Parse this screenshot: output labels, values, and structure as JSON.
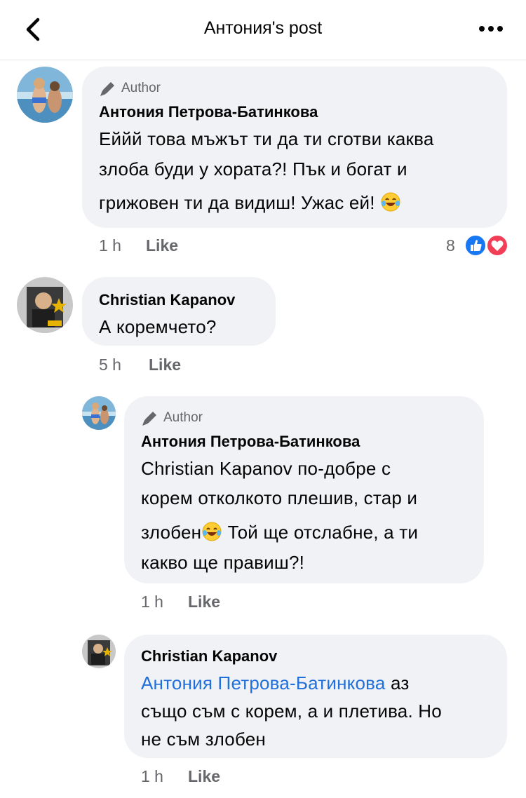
{
  "header": {
    "title": "Антония's post"
  },
  "comments": [
    {
      "author_badge": "Author",
      "name": "Антония Петрова-Батинкова",
      "lines": [
        "Еййй това мъжът ти да ти сготви каква",
        "злоба буди у хората?! Пък и богат и",
        "грижовен ти да видиш! Ужас ей!"
      ],
      "time": "1 h",
      "like_label": "Like",
      "reaction_count": "8"
    },
    {
      "name": "Christian Kapanov",
      "lines": [
        "А коремчето?"
      ],
      "time": "5 h",
      "like_label": "Like"
    },
    {
      "author_badge": "Author",
      "name": "Антония Петрова-Батинкова",
      "lines": [
        "Christian Kapanov по-добре с",
        "корем отколкото плешив, стар и",
        "злобен",
        " Той ще отслабне, а ти",
        "какво ще правиш?!"
      ],
      "time": "1 h",
      "like_label": "Like"
    },
    {
      "name": "Christian Kapanov",
      "mention": "Антония Петрова-Батинкова",
      "lines": [
        " аз",
        "също съм с корем, а и плетива. Но",
        "не съм злобен"
      ],
      "time": "1 h",
      "like_label": "Like"
    }
  ],
  "colors": {
    "bubble": "#f0f2f5",
    "mention": "#216fdb",
    "like_blue": "#1877f2",
    "love_red": "#f33e58",
    "meta": "#65676b"
  },
  "icons": [
    "back-icon",
    "more-icon",
    "pencil-icon",
    "laughing-emoji-icon",
    "like-reaction-icon",
    "love-reaction-icon"
  ]
}
